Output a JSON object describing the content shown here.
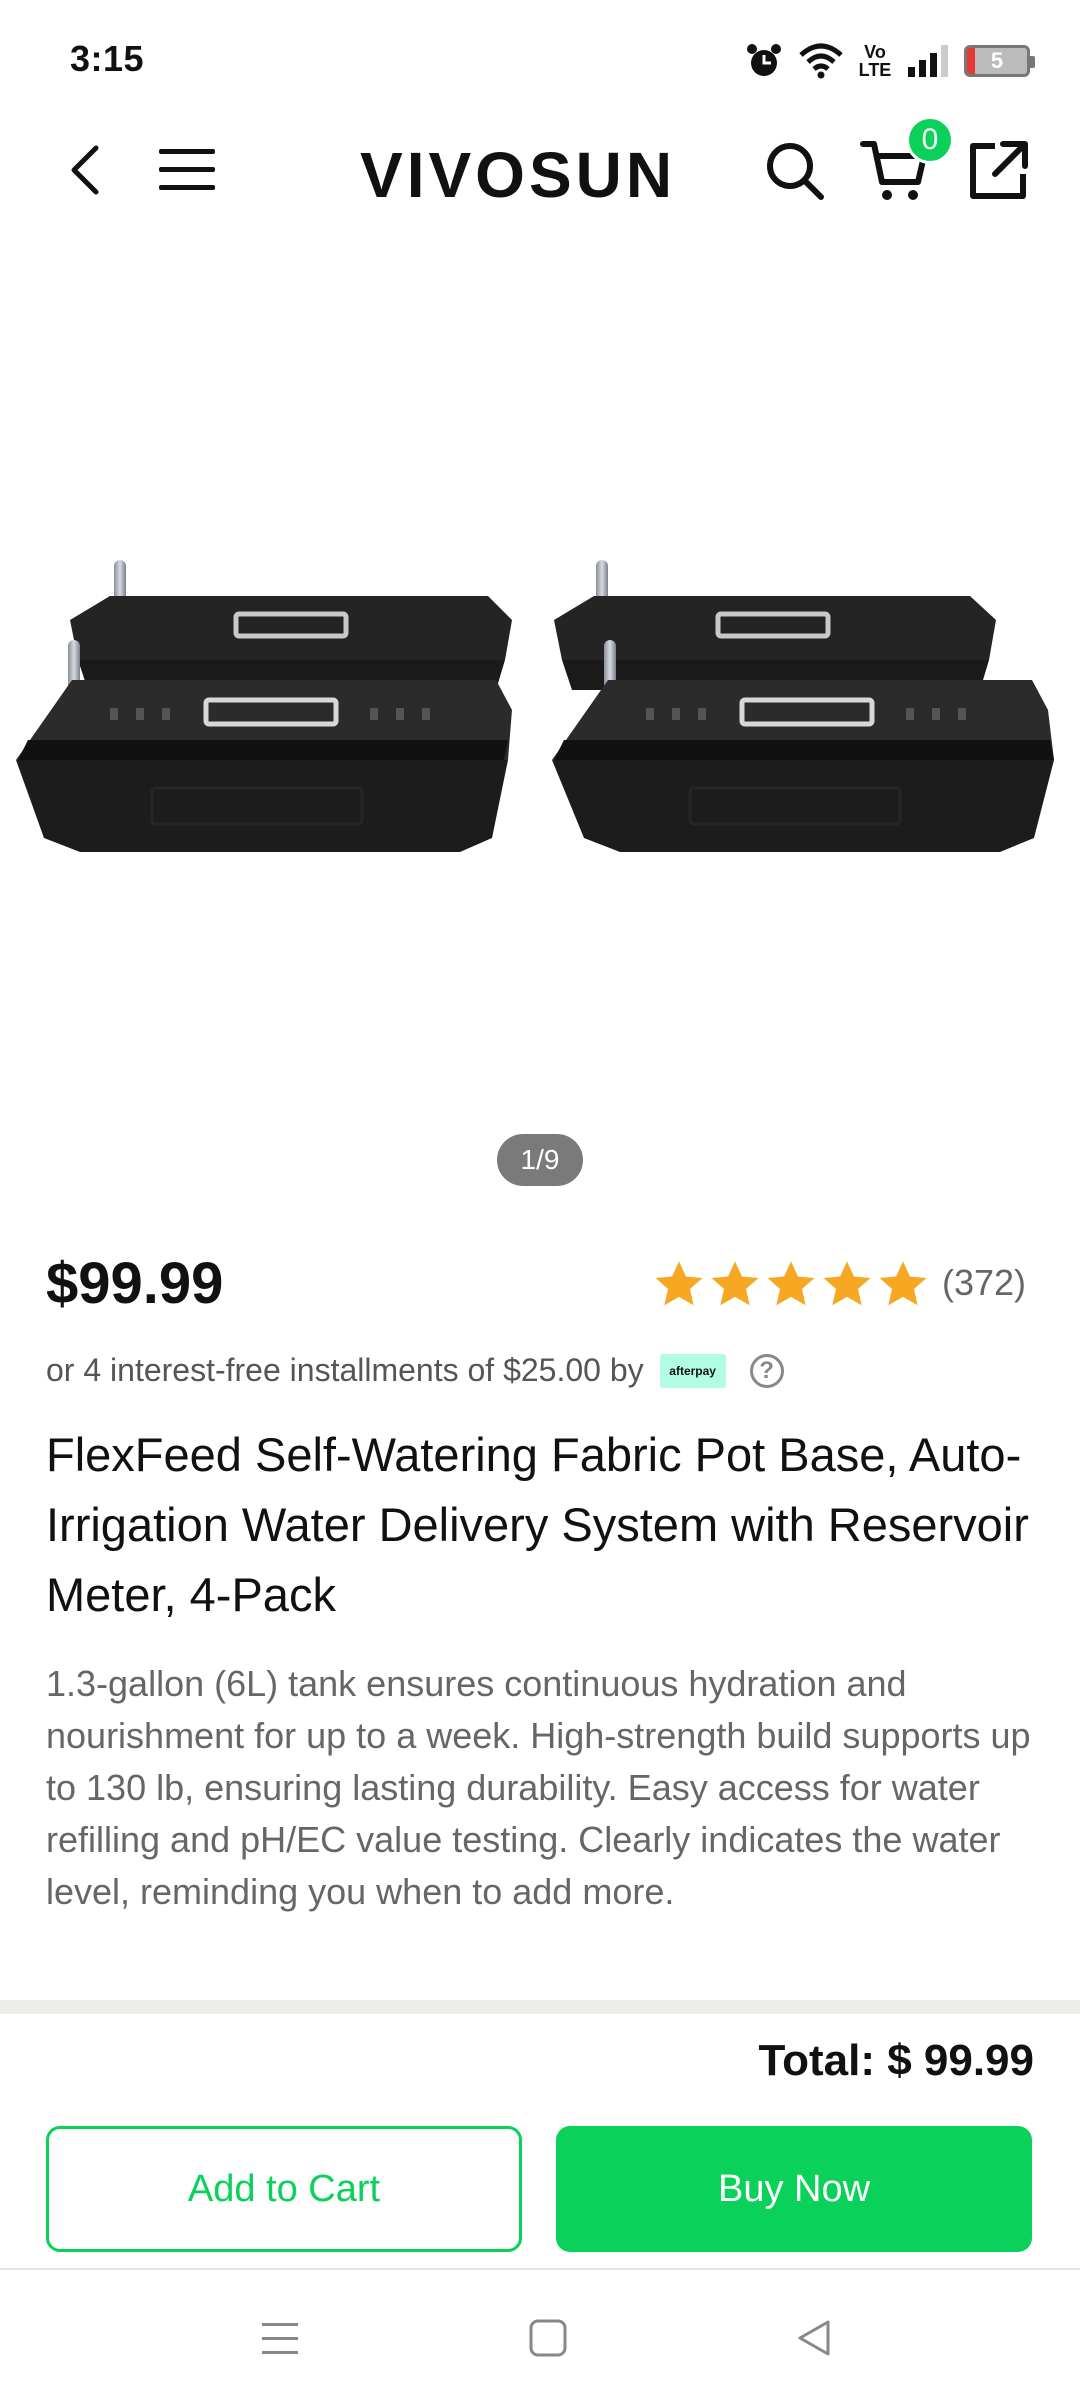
{
  "status_bar": {
    "time": "3:15",
    "volte": "Vo LTE",
    "battery": "5",
    "icons": [
      "alarm-icon",
      "wifi-icon",
      "volte-icon",
      "signal-icon",
      "battery-icon"
    ]
  },
  "nav": {
    "logo": "VIVOSUN",
    "cart_count": "0",
    "icons": [
      "back-icon",
      "menu-icon",
      "search-icon",
      "cart-icon",
      "share-icon"
    ]
  },
  "gallery": {
    "pager": "1/9"
  },
  "product": {
    "price": "$99.99",
    "rating": 5,
    "review_count": "(372)",
    "installments": "or 4 interest-free installments of $25.00 by",
    "afterpay_label": "afterpay",
    "help": "?",
    "title": "FlexFeed Self-Watering Fabric Pot Base, Auto-Irrigation Water Delivery System with Reservoir Meter, 4-Pack",
    "description": "1.3-gallon (6L) tank ensures continuous hydration and nourishment for up to a week. High-strength build supports up to 130 lb, ensuring lasting durability. Easy access for water refilling and pH/EC value testing. Clearly indicates the water level, reminding you when to add more."
  },
  "checkout": {
    "total": "Total: $ 99.99",
    "add_to_cart": "Add to Cart",
    "buy_now": "Buy Now"
  },
  "colors": {
    "accent": "#0ad15a",
    "star": "#f6a823",
    "afterpay_mint": "#b2fce4"
  },
  "system_nav": [
    "recents-icon",
    "home-icon",
    "back-triangle-icon"
  ]
}
